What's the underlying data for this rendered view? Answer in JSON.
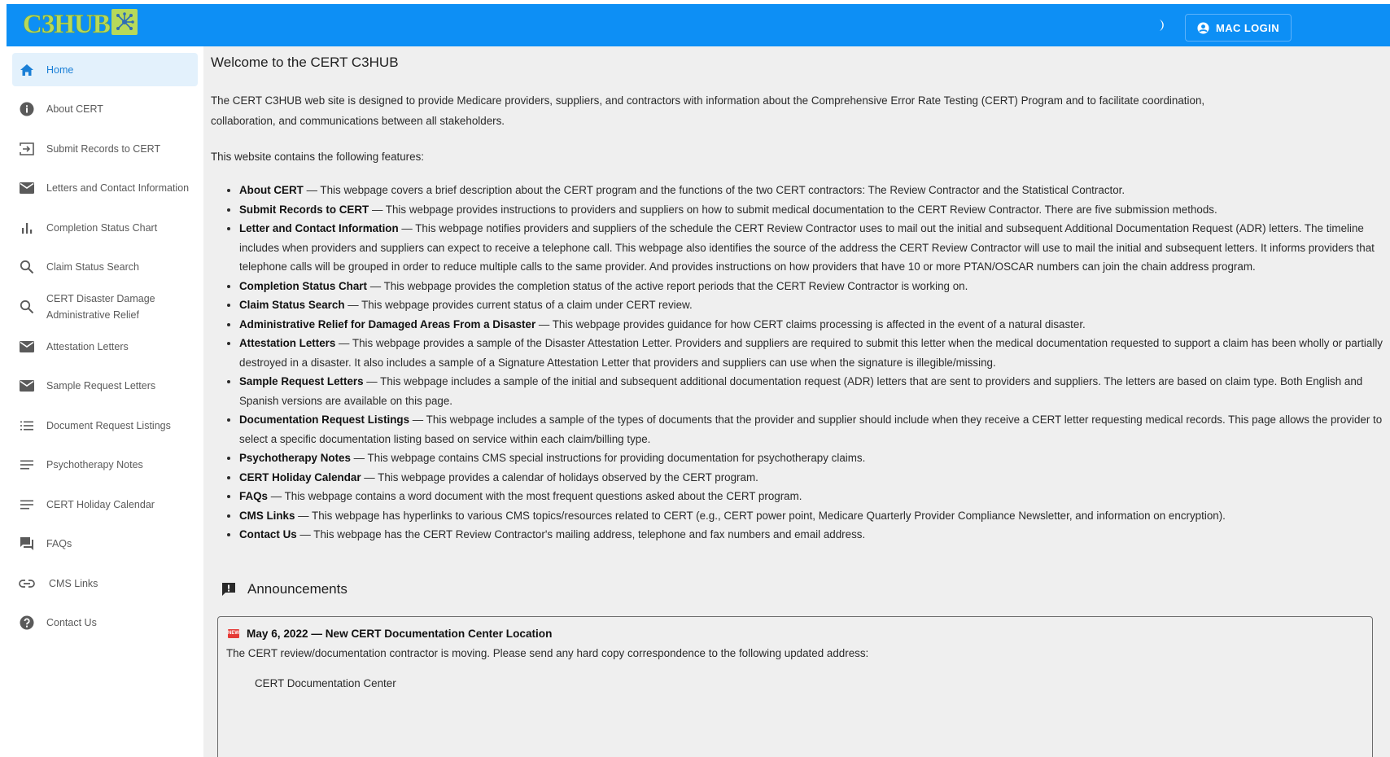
{
  "header": {
    "logo_text": "C3HUB",
    "theme_toggle_icon": "moon-icon",
    "login_label": "MAC LOGIN",
    "brand_color": "#0d8ff5"
  },
  "sidebar": {
    "items": [
      {
        "label": "Home",
        "icon": "home-icon",
        "active": true
      },
      {
        "label": "About CERT",
        "icon": "info-icon"
      },
      {
        "label": "Submit Records to CERT",
        "icon": "login-arrow-icon"
      },
      {
        "label": "Letters and Contact Information",
        "icon": "mail-icon"
      },
      {
        "label": "Completion Status Chart",
        "icon": "bar-chart-icon"
      },
      {
        "label": "Claim Status Search",
        "icon": "search-icon"
      },
      {
        "label": "CERT Disaster Damage Administrative Relief",
        "icon": "search-icon"
      },
      {
        "label": "Attestation Letters",
        "icon": "mail-icon"
      },
      {
        "label": "Sample Request Letters",
        "icon": "mail-icon"
      },
      {
        "label": "Document Request Listings",
        "icon": "list-icon"
      },
      {
        "label": "Psychotherapy Notes",
        "icon": "notes-icon"
      },
      {
        "label": "CERT Holiday Calendar",
        "icon": "notes-icon"
      },
      {
        "label": "FAQs",
        "icon": "forum-icon"
      },
      {
        "label": "CMS Links",
        "icon": "link-icon"
      },
      {
        "label": "Contact Us",
        "icon": "help-icon"
      }
    ]
  },
  "main": {
    "title": "Welcome to the CERT C3HUB",
    "intro": "The CERT C3HUB web site is designed to provide Medicare providers, suppliers, and contractors with information about the Comprehensive Error Rate Testing (CERT) Program and to facilitate coordination, collaboration, and communications between all stakeholders.",
    "features_intro": "This website contains the following features:",
    "features": [
      {
        "name": "About CERT",
        "desc": " — This webpage covers a brief description about the CERT program and the functions of the two CERT contractors: The Review Contractor and the Statistical Contractor."
      },
      {
        "name": "Submit Records to CERT",
        "desc": " — This webpage provides instructions to providers and suppliers on how to submit medical documentation to the CERT Review Contractor. There are five submission methods."
      },
      {
        "name": "Letter and Contact Information",
        "desc": " — This webpage notifies providers and suppliers of the schedule the CERT Review Contractor uses to mail out the initial and subsequent Additional Documentation Request (ADR) letters. The timeline includes when providers and suppliers can expect to receive a telephone call. This webpage also identifies the source of the address the CERT Review Contractor will use to mail the initial and subsequent letters. It informs providers that telephone calls will be grouped in order to reduce multiple calls to the same provider. And provides instructions on how providers that have 10 or more PTAN/OSCAR numbers can join the chain address program."
      },
      {
        "name": "Completion Status Chart",
        "desc": " — This webpage provides the completion status of the active report periods that the CERT Review Contractor is working on."
      },
      {
        "name": "Claim Status Search",
        "desc": " — This webpage provides current status of a claim under CERT review."
      },
      {
        "name": "Administrative Relief for Damaged Areas From a Disaster",
        "desc": " — This webpage provides guidance for how CERT claims processing is affected in the event of a natural disaster."
      },
      {
        "name": "Attestation Letters",
        "desc": " — This webpage provides a sample of the Disaster Attestation Letter. Providers and suppliers are required to submit this letter when the medical documentation requested to support a claim has been wholly or partially destroyed in a disaster. It also includes a sample of a Signature Attestation Letter that providers and suppliers can use when the signature is illegible/missing."
      },
      {
        "name": "Sample Request Letters",
        "desc": " — This webpage includes a sample of the initial and subsequent additional documentation request (ADR) letters that are sent to providers and suppliers. The letters are based on claim type. Both English and Spanish versions are available on this page."
      },
      {
        "name": "Documentation Request Listings",
        "desc": " — This webpage includes a sample of the types of documents that the provider and supplier should include when they receive a CERT letter requesting medical records. This page allows the provider to select a specific documentation listing based on service within each claim/billing type."
      },
      {
        "name": "Psychotherapy Notes",
        "desc": " — This webpage contains CMS special instructions for providing documentation for psychotherapy claims."
      },
      {
        "name": "CERT Holiday Calendar",
        "desc": " — This webpage provides a calendar of holidays observed by the CERT program."
      },
      {
        "name": "FAQs",
        "desc": " — This webpage contains a word document with the most frequent questions asked about the CERT program."
      },
      {
        "name": "CMS Links",
        "desc": " — This webpage has hyperlinks to various CMS topics/resources related to CERT (e.g., CERT power point, Medicare Quarterly Provider Compliance Newsletter, and information on encryption)."
      },
      {
        "name": "Contact Us",
        "desc": " — This webpage has the CERT Review Contractor's mailing address, telephone and fax numbers and email address."
      }
    ],
    "announcements": {
      "heading": "Announcements",
      "items": [
        {
          "badge": "NEW",
          "title": "May 6, 2022 — New CERT Documentation Center Location",
          "body": "The CERT review/documentation contractor is moving. Please send any hard copy correspondence to the following updated address:",
          "address_line": "CERT Documentation Center"
        }
      ]
    }
  }
}
